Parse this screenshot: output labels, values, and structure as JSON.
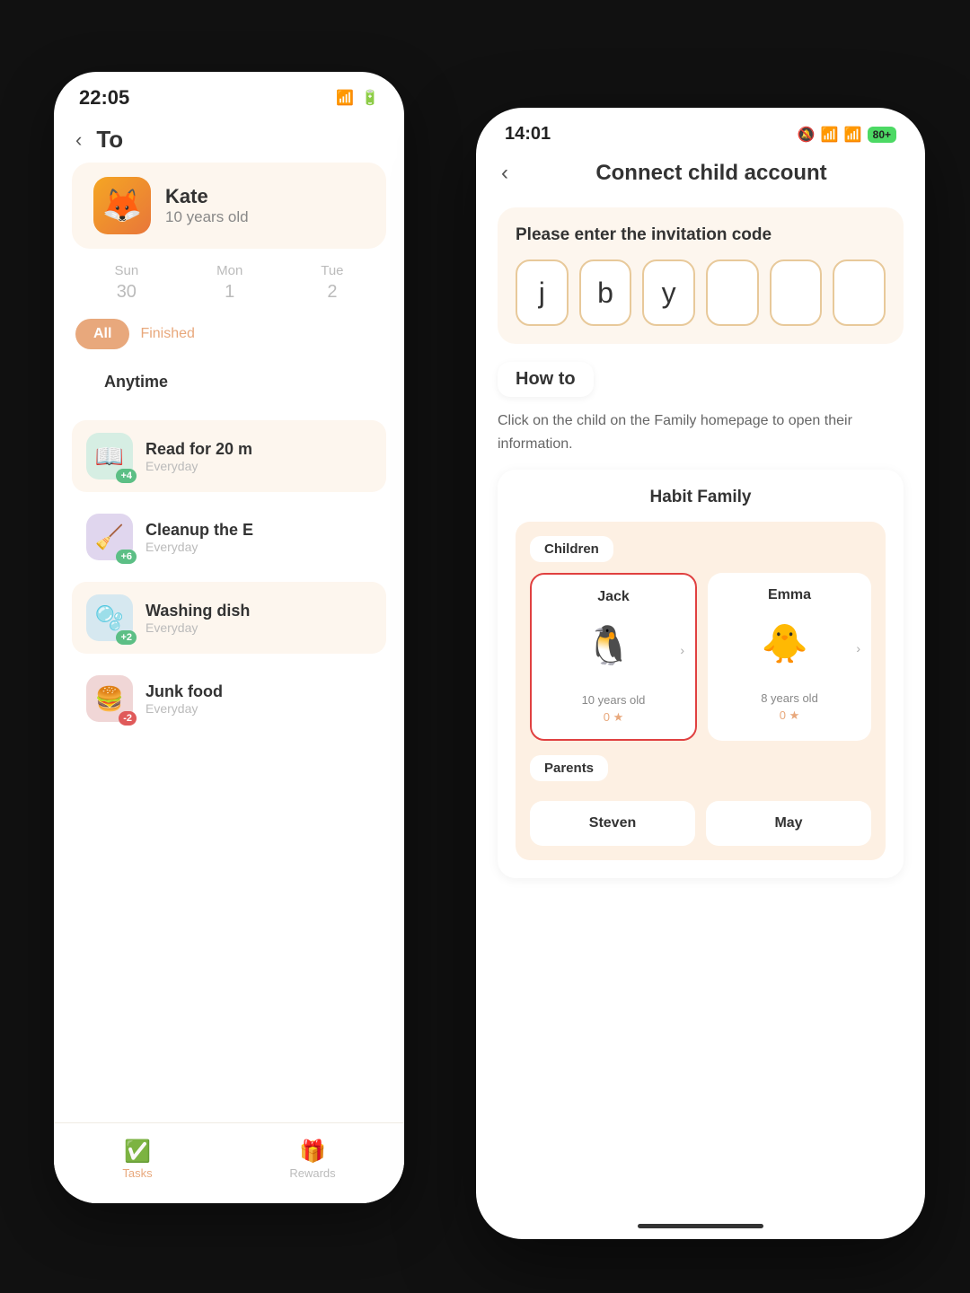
{
  "back_phone": {
    "status": {
      "time": "22:05",
      "wifi": "📶",
      "battery": "🔋"
    },
    "header": {
      "back_label": "‹",
      "title": "To"
    },
    "profile": {
      "name": "Kate",
      "age": "10 years old",
      "avatar_emoji": "🦊"
    },
    "calendar": [
      {
        "label": "Sun",
        "num": "30"
      },
      {
        "label": "Mon",
        "num": "1"
      },
      {
        "label": "Tue",
        "num": "2"
      }
    ],
    "filters": {
      "active": "All",
      "inactive": "Finished"
    },
    "section_label": "Anytime",
    "tasks": [
      {
        "icon": "📖",
        "name": "Read for 20 m",
        "freq": "Everyday",
        "badge": "+4",
        "badge_type": "pos",
        "bg": "#d6eee3"
      },
      {
        "icon": "🧹",
        "name": "Cleanup the E",
        "freq": "Everyday",
        "badge": "+6",
        "badge_type": "pos",
        "bg": "#e0d6ee"
      },
      {
        "icon": "🫧",
        "name": "Washing dish",
        "freq": "Everyday",
        "badge": "+2",
        "badge_type": "pos",
        "bg": "#d6e8f0"
      },
      {
        "icon": "🍔",
        "name": "Junk food",
        "freq": "Everyday",
        "badge": "-2",
        "badge_type": "neg",
        "bg": "#f0d6d6"
      }
    ],
    "nav": [
      {
        "icon": "✅",
        "label": "Tasks",
        "active": true
      },
      {
        "icon": "🎁",
        "label": "Rewards",
        "active": false
      }
    ]
  },
  "front_phone": {
    "status": {
      "time": "14:01",
      "mute": "🔕",
      "signal": "📶",
      "wifi": "📶",
      "battery_pct": "80+"
    },
    "header": {
      "back_label": "‹",
      "title": "Connect child account"
    },
    "invite": {
      "label": "Please enter the invitation code",
      "code_chars": [
        "j",
        "b",
        "y",
        "",
        "",
        ""
      ]
    },
    "howto": {
      "label": "How to",
      "description": "Click on the child on the Family homepage to open their information."
    },
    "family": {
      "title": "Habit Family",
      "children_label": "Children",
      "children": [
        {
          "name": "Jack",
          "avatar": "🐧",
          "age": "10 years old",
          "stars": "0 ★",
          "selected": true
        },
        {
          "name": "Emma",
          "avatar": "🐥",
          "age": "8 years old",
          "stars": "0 ★",
          "selected": false
        }
      ],
      "parents_label": "Parents",
      "parents": [
        {
          "name": "Steven"
        },
        {
          "name": "May"
        }
      ]
    }
  }
}
